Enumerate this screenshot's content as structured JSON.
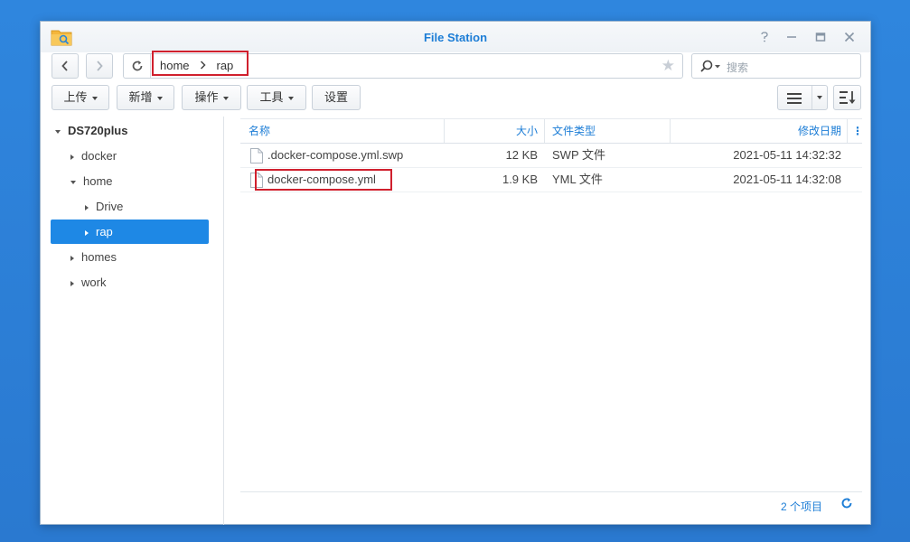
{
  "window": {
    "title": "File Station",
    "controls": [
      "help-icon",
      "minimize-icon",
      "maximize-icon",
      "close-icon"
    ]
  },
  "navigation": {
    "back_icon": "chevron-left-icon",
    "forward_icon": "chevron-right-icon",
    "refresh_icon": "refresh-icon",
    "path": [
      "home",
      "rap"
    ],
    "favorite_icon": "star-icon"
  },
  "search": {
    "placeholder": "搜索"
  },
  "toolbar": {
    "upload_label": "上传",
    "create_label": "新增",
    "action_label": "操作",
    "tools_label": "工具",
    "settings_label": "设置"
  },
  "sidebar": {
    "root": "DS720plus",
    "items": [
      {
        "label": "docker",
        "state": "collapsed"
      },
      {
        "label": "home",
        "state": "expanded"
      },
      {
        "label": "Drive",
        "state": "collapsed"
      },
      {
        "label": "rap",
        "state": "selected"
      },
      {
        "label": "homes",
        "state": "collapsed"
      },
      {
        "label": "work",
        "state": "collapsed"
      }
    ]
  },
  "file_list": {
    "columns": [
      "名称",
      "大小",
      "文件类型",
      "修改日期"
    ],
    "rows": [
      {
        "name": ".docker-compose.yml.swp",
        "size": "12 KB",
        "type": "SWP 文件",
        "modified": "2021-05-11 14:32:32"
      },
      {
        "name": "docker-compose.yml",
        "size": "1.9 KB",
        "type": "YML 文件",
        "modified": "2021-05-11 14:32:08"
      }
    ]
  },
  "footer": {
    "item_count": "2 个项目"
  },
  "colors": {
    "accent": "#1c7dd6",
    "selection": "#1e88e5",
    "highlight_box": "#d0202e",
    "desktop": "#2f86de"
  }
}
